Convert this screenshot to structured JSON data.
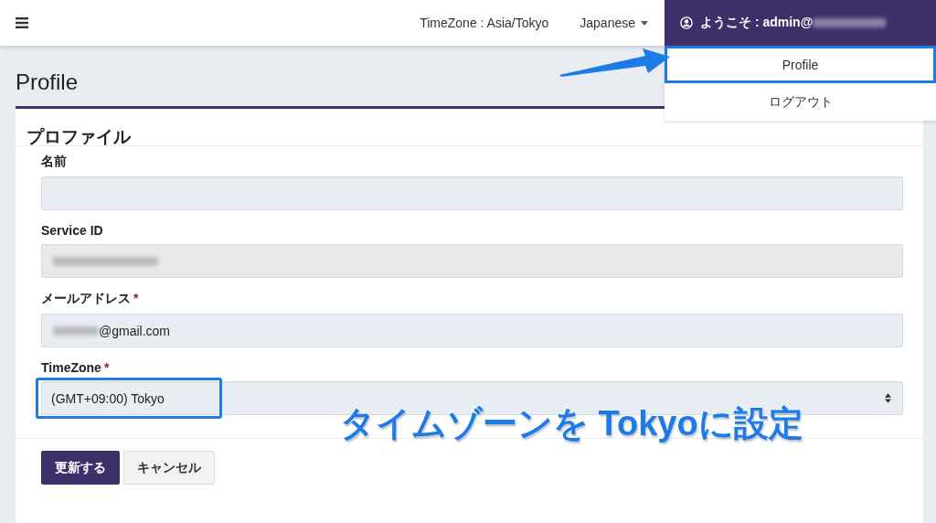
{
  "navbar": {
    "timezone": "TimeZone : Asia/Tokyo",
    "language": "Japanese",
    "user": "ようこそ : admin@"
  },
  "user_menu": {
    "items": [
      {
        "label": "Profile",
        "highlighted": true
      },
      {
        "label": "ログアウト",
        "highlighted": false
      }
    ]
  },
  "page_title": "Profile",
  "card": {
    "title": "プロファイル",
    "fields": [
      {
        "kind": "text",
        "label": "名前",
        "redacted": false,
        "highlighted": false
      },
      {
        "kind": "readonly",
        "label": "Service ID",
        "redacted": true,
        "highlighted": false
      },
      {
        "kind": "text",
        "label": "メールアドレス",
        "required_mark": "*",
        "value": "@gmail.com",
        "redacted": true,
        "highlighted": false
      },
      {
        "kind": "select",
        "label": "TimeZone",
        "required_mark": "*",
        "value": "(GMT+09:00) Tokyo",
        "redacted": false,
        "highlighted": true
      }
    ],
    "buttons": [
      {
        "label": "更新する",
        "kind": "primary"
      },
      {
        "label": "キャンセル",
        "kind": "secondary"
      }
    ]
  },
  "annotation": {
    "callout": "タイムゾーンを Tokyoに設定"
  }
}
